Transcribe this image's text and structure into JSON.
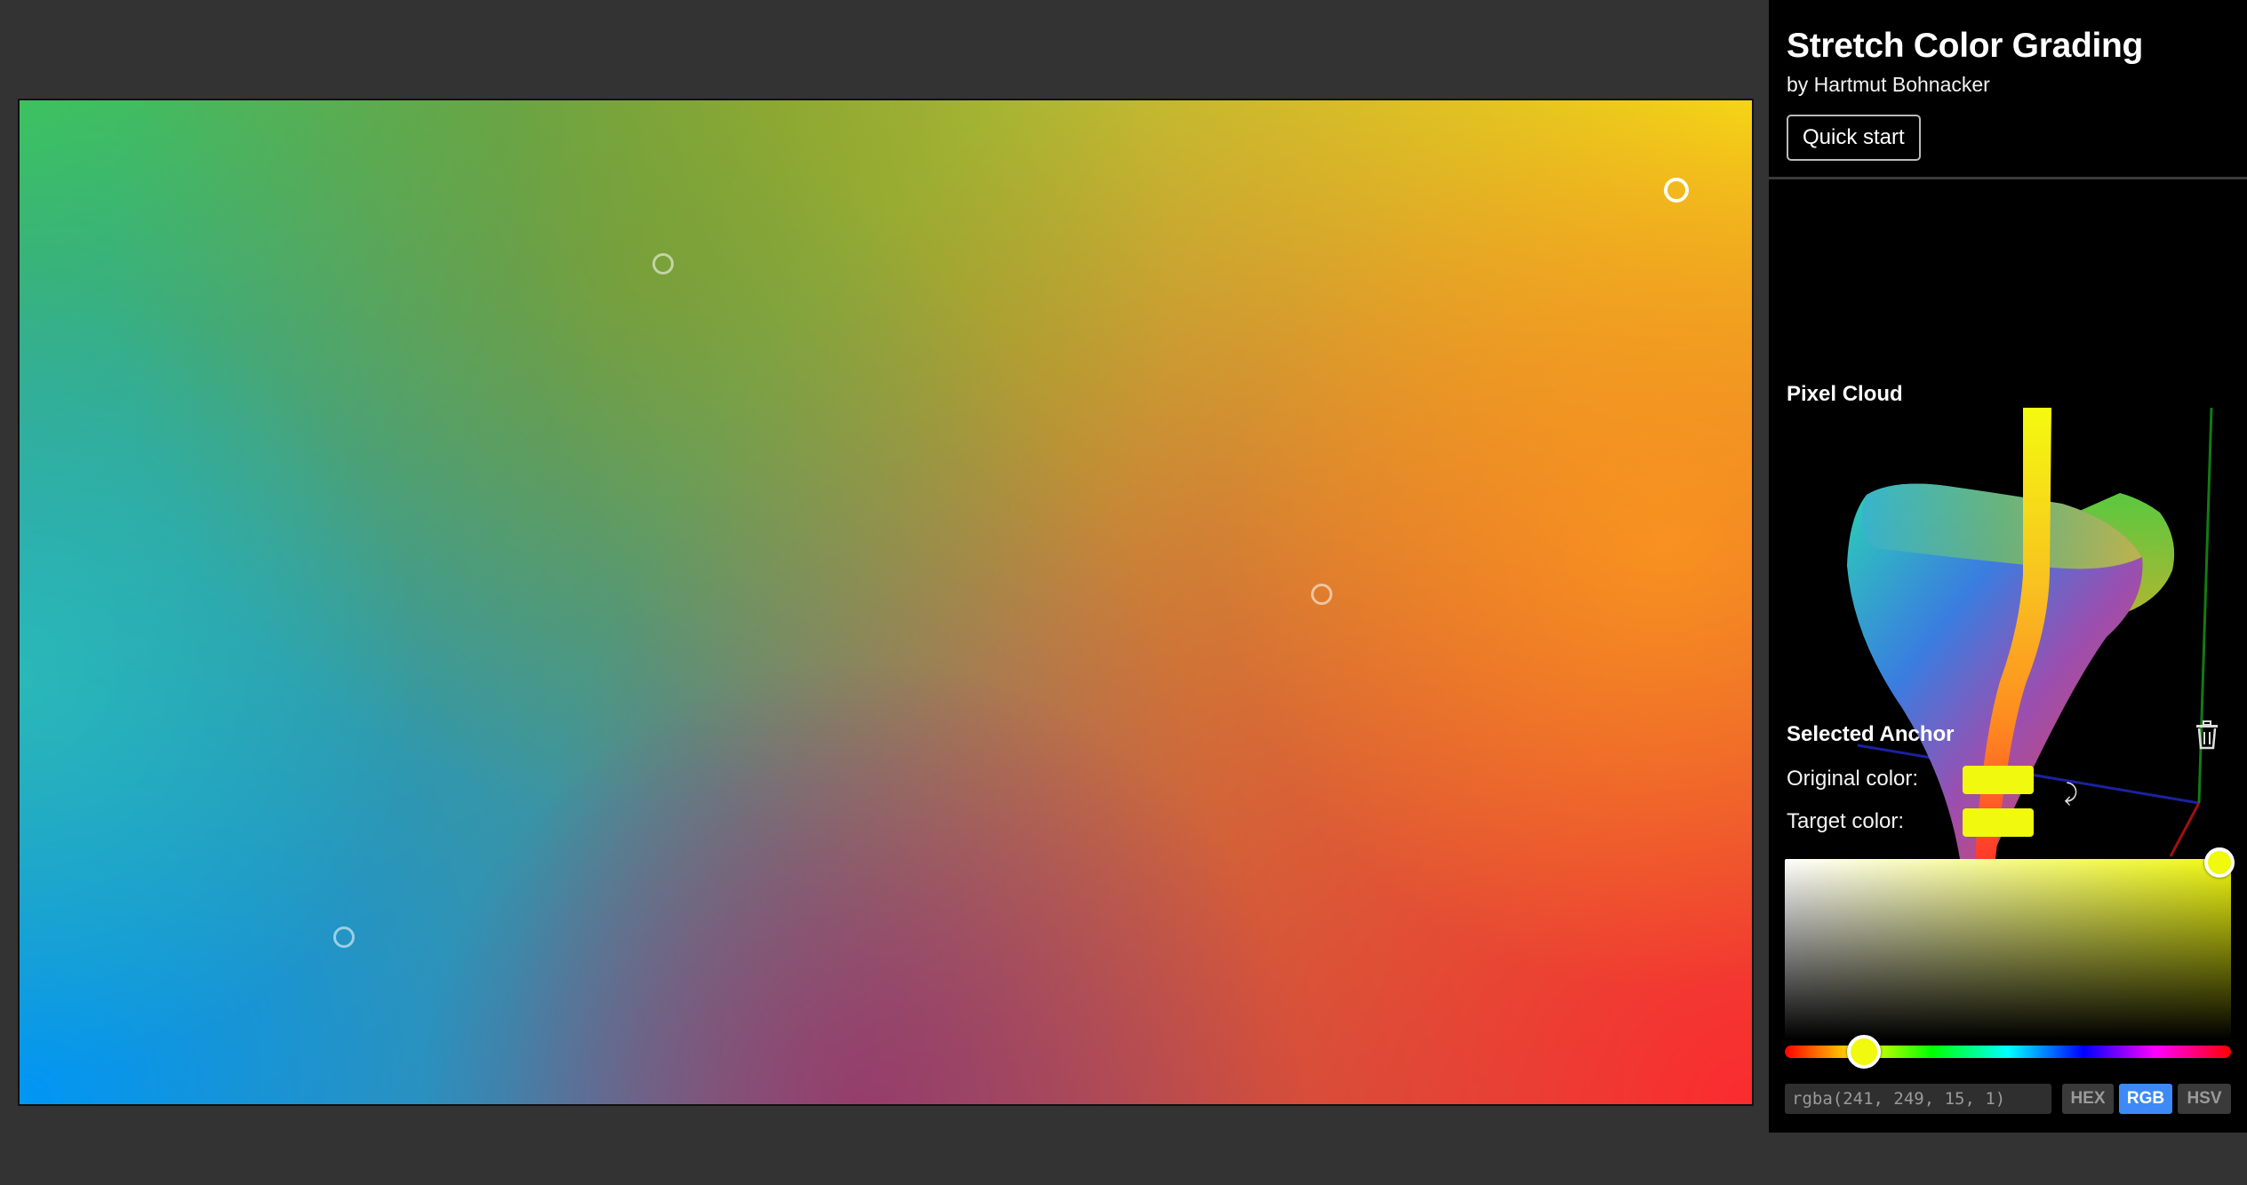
{
  "app": {
    "title": "Stretch Color Grading",
    "author": "by Hartmut Bohnacker",
    "quick_start_label": "Quick start"
  },
  "canvas": {
    "corner_colors": {
      "top_left": "#4bcc3c",
      "top_right": "#f0fb12",
      "bottom_left": "#0096f5",
      "bottom_right": "#fb2b2f"
    },
    "anchors": [
      {
        "name": "anchor-green",
        "selected": false
      },
      {
        "name": "anchor-yellow",
        "selected": true
      },
      {
        "name": "anchor-orange",
        "selected": false
      },
      {
        "name": "anchor-blue",
        "selected": false
      }
    ]
  },
  "pixel_cloud": {
    "title": "Pixel Cloud"
  },
  "selected_anchor": {
    "title": "Selected Anchor",
    "delete_icon": "trash-icon",
    "swap_icon": "swap-arrow-icon",
    "swap_glyph": "⤸",
    "original_label": "Original color:",
    "target_label": "Target color:",
    "original_color": "#f1f90f",
    "target_color": "#f1f90f",
    "color_value": "rgba(241, 249, 15, 1)",
    "modes": [
      "HEX",
      "RGB",
      "HSV"
    ],
    "active_mode": "RGB"
  }
}
